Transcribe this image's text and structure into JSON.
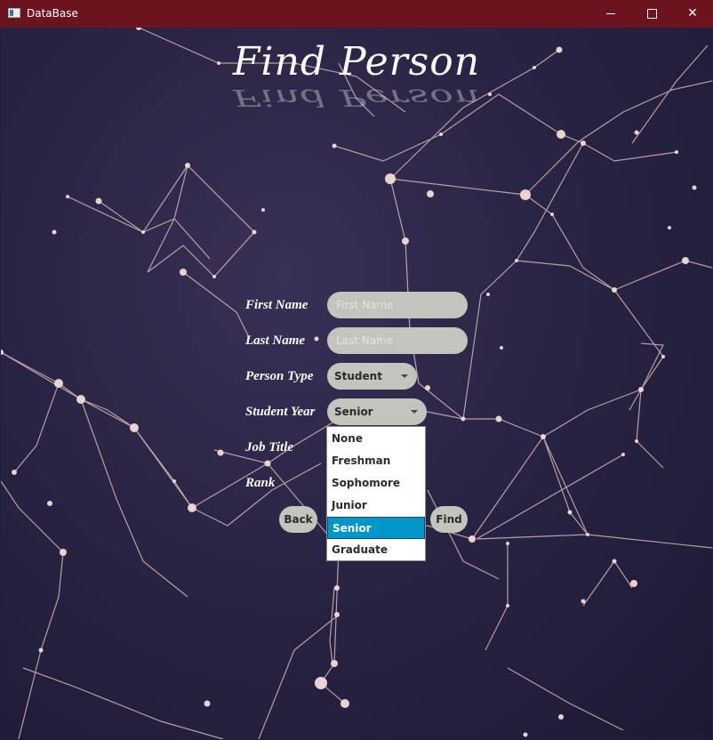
{
  "window": {
    "title": "DataBase",
    "controls": {
      "minimize": "minimize",
      "maximize": "maximize",
      "close": "✕"
    }
  },
  "heading": "Find Person",
  "form": {
    "first_name": {
      "label": "First Name",
      "placeholder": "First Name",
      "value": ""
    },
    "last_name": {
      "label": "Last Name",
      "placeholder": "Last Name",
      "value": ""
    },
    "person_type": {
      "label": "Person Type",
      "value": "Student"
    },
    "student_year": {
      "label": "Student Year",
      "value": "Senior",
      "options": [
        "None",
        "Freshman",
        "Sophomore",
        "Junior",
        "Senior",
        "Graduate"
      ],
      "selected_option": "Senior"
    },
    "job_title": {
      "label": "Job Title"
    },
    "rank": {
      "label": "Rank"
    }
  },
  "buttons": {
    "back": "Back",
    "find": "Find"
  },
  "colors": {
    "titlebar": "#6b141f",
    "background": "#211d3c",
    "control": "#c2c4bd",
    "selection": "#0096c9",
    "network_lines": "#e8c9c7"
  }
}
